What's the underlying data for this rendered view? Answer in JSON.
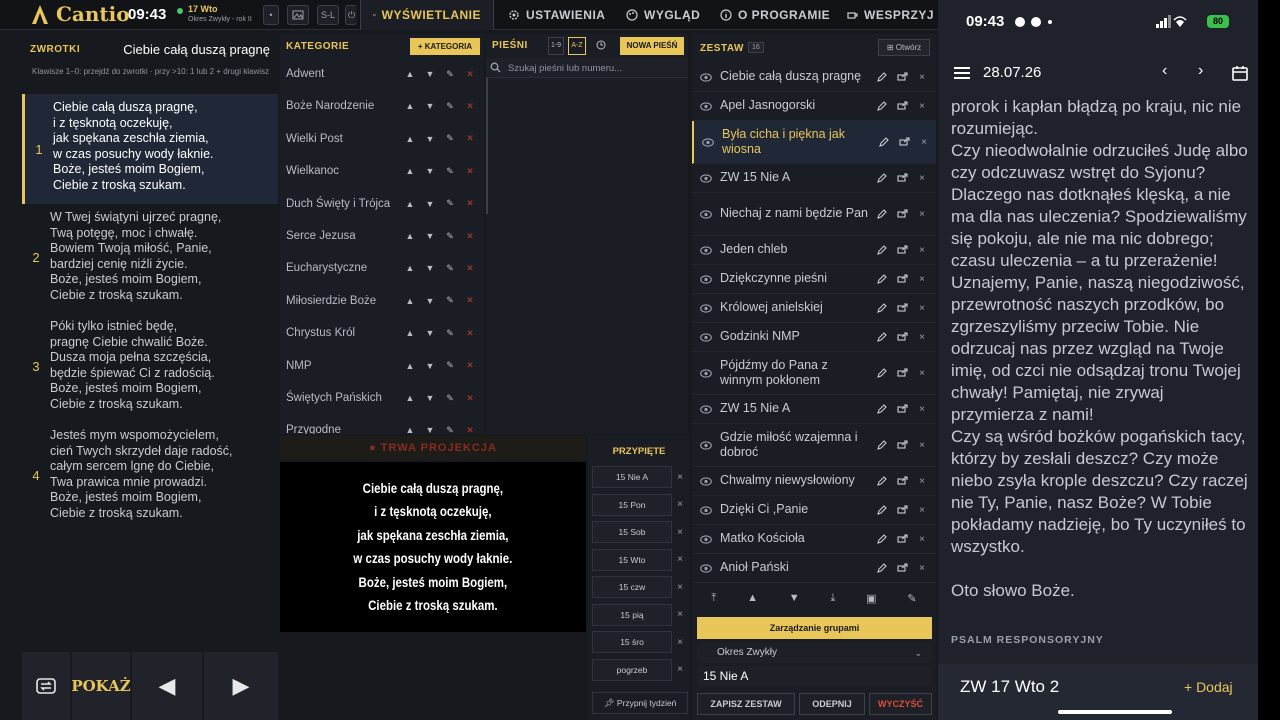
{
  "app": {
    "name": "Cantio",
    "clock": "09:43",
    "date_label": "17 Wto",
    "date_sub": "Okres Zwykły - rok II"
  },
  "toolbar": {
    "btn_sl": "S-L"
  },
  "nav_tabs": [
    {
      "label": "WYŚWIETLANIE",
      "icon": "monitor-icon"
    },
    {
      "label": "USTAWIENIA",
      "icon": "gear-icon"
    },
    {
      "label": "WYGLĄD",
      "icon": "palette-icon"
    },
    {
      "label": "O PROGRAMIE",
      "icon": "info-icon"
    },
    {
      "label": "WESPRZYJ",
      "icon": "coffee-icon"
    }
  ],
  "verses_panel": {
    "title": "ZWROTKI",
    "song_title": "Ciebie całą duszą pragnę",
    "hint": "Klawisze 1–0: przejdź do zwrotki · przy >10: 1 lub 2 + drugi klawisz",
    "verses": [
      {
        "num": "1",
        "lines": [
          "Ciebie całą duszą pragnę,",
          "i z tęsknotą oczekuję,",
          "jak spękana zeschła ziemia,",
          "w czas posuchy wody łaknie.",
          "Boże, jesteś moim Bogiem,",
          "Ciebie z troską szukam."
        ]
      },
      {
        "num": "2",
        "lines": [
          "W Twej świątyni ujrzeć pragnę,",
          "Twą potęgę, moc i chwałę.",
          "Bowiem Twoją miłość, Panie,",
          "bardziej cenię niźli życie.",
          "Boże, jesteś moim Bogiem,",
          "Ciebie z troską szukam."
        ]
      },
      {
        "num": "3",
        "lines": [
          "Póki tylko istnieć będę,",
          "pragnę Ciebie chwalić Boże.",
          "Dusza moja pełna szczęścia,",
          "będzie śpiewać Ci z radością.",
          "Boże, jesteś moim Bogiem,",
          "Ciebie z troską szukam."
        ]
      },
      {
        "num": "4",
        "lines": [
          "Jesteś mym wspomożycielem,",
          "cień Twych skrzydeł daje radość,",
          "całym sercem lgnę do Ciebie,",
          "Twa prawica mnie prowadzi.",
          "Boże, jesteś moim Bogiem,",
          "Ciebie z troską szukam."
        ]
      }
    ]
  },
  "categories": {
    "title": "KATEGORIE",
    "add_label": "+ KATEGORIA",
    "items": [
      "Adwent",
      "Boże Narodzenie",
      "Wielki Post",
      "Wielkanoc",
      "Duch Święty i Trójca",
      "Serce Jezusa",
      "Eucharystyczne",
      "Miłosierdzie Boże",
      "Chrystus Król",
      "NMP",
      "Świętych Pańskich",
      "Przygodne"
    ],
    "act_up": "▲",
    "act_down": "▼",
    "act_edit": "✎",
    "act_delete": "✕"
  },
  "songs": {
    "title": "PIEŚNI",
    "sort_num": "1-9",
    "sort_az": "A-Z",
    "new_label": "NOWA PIEŚŃ",
    "search_placeholder": "Szukaj pieśni lub numeru..."
  },
  "projection": {
    "title": "● TRWA PROJEKCJA",
    "lines": [
      "Ciebie całą duszą pragnę,",
      "i z tęsknotą oczekuję,",
      "jak spękana zeschła ziemia,",
      "w czas posuchy wody łaknie.",
      "Boże, jesteś moim Bogiem,",
      "Ciebie z troską szukam."
    ]
  },
  "pinned": {
    "title": "PRZYPIĘTE",
    "items": [
      "15 Nie A",
      "15 Pon",
      "15 Sob",
      "15 Wto",
      "15 czw",
      "15 pią",
      "15 śro",
      "pogrzeb"
    ],
    "pin_week": "Przypnij tydzień"
  },
  "controls": {
    "show_label": "POKAŻ",
    "prev_glyph": "◀",
    "next_glyph": "▶"
  },
  "set_panel": {
    "title": "ZESTAW",
    "count": "16",
    "open_label": "⊞ Otwórz",
    "items": [
      "Ciebie całą duszą pragnę",
      "Apel Jasnogorski",
      "Była cicha i piękna jak wiosna",
      "ZW 15 Nie A",
      "Niechaj z nami będzie Pan",
      "Jeden chleb",
      "Dziękczynne pieśni",
      "Królowej anielskiej",
      "Godzinki NMP",
      "Pójdźmy do Pana z winnym pokłonem",
      "ZW 15 Nie A",
      "Gdzie miłość wzajemna i dobroć",
      "Chwalmy niewysłowiony",
      "Dzięki Ci ,Panie",
      "Matko Kościoła",
      "Anioł Pański"
    ],
    "active_index": 2,
    "groups_label": "Zarządzanie grupami",
    "period_value": "Okres Zwykły",
    "set_name_value": "15 Nie A",
    "save_label": "ZAPISZ ZESTAW",
    "unpin_label": "ODEPNIJ",
    "clear_label": "WYCZYŚĆ"
  },
  "phone": {
    "time": "09:43",
    "battery": "80",
    "date": "28.07.26",
    "reading": "prorok i kapłan błądzą po kraju, nic nie rozumiejąc.\nCzy nieodwołalnie odrzuciłeś Judę albo czy odczuwasz wstręt do Syjonu? Dlaczego nas dotknąłeś klęską, a nie ma dla nas uleczenia? Spodziewaliśmy się pokoju, ale nie ma nic dobrego; czasu uleczenia – a tu przerażenie!\nUznajemy, Panie, naszą niegodziwość, przewrotność naszych przodków, bo zgrzeszyliśmy przeciw Tobie. Nie odrzucaj nas przez wzgląd na Twoje imię, od czci nie odsądzaj tronu Twojej chwały! Pamiętaj, nie zrywaj przymierza z nami!\nCzy są wśród bożków pogańskich tacy, którzy by zesłali deszcz? Czy może niebo zsyła krople deszczu? Czy raczej nie Ty, Panie, nasz Boże? W Tobie pokładamy nadzieję, bo Ty uczyniłeś to wszystko.\n\nOto słowo Boże.",
    "psalm_heading": "PSALM RESPONSORYJNY",
    "day_label": "ZW 17 Wto 2",
    "add_label": "+ Dodaj"
  },
  "colors": {
    "accent": "#e8c65a",
    "danger": "#c0392b",
    "panel": "#1a1d23",
    "active": "#202837"
  }
}
